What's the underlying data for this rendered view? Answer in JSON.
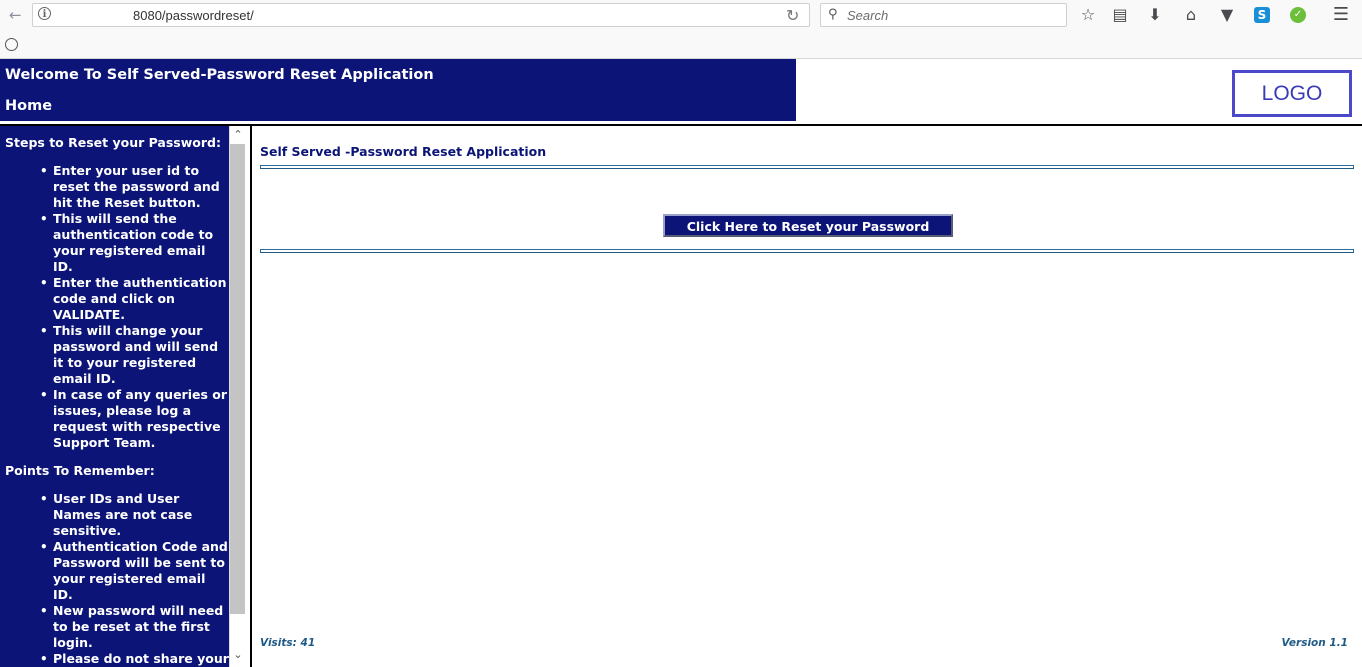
{
  "browser": {
    "url": "8080/passwordreset/",
    "search_placeholder": "Search"
  },
  "header": {
    "title": "Welcome To       Self Served-Password Reset Application",
    "home_link": "Home",
    "logo_text": "LOGO"
  },
  "sidebar": {
    "steps_heading": "Steps to Reset your       Password:",
    "steps": [
      "Enter your user id to reset the password and hit the Reset button.",
      "This will send the authentication code to your registered email ID.",
      "Enter the authentication code and click on VALIDATE.",
      "This will change your password and will send it to your registered email ID.",
      "In case of any queries or issues, please log a       request with respective Support Team."
    ],
    "points_heading": "Points To Remember:",
    "points": [
      "User IDs and User Names are not case sensitive.",
      "Authentication Code and Password will be sent to your registered email ID.",
      "New password will need to be reset at the first login.",
      "Please do not share your password with any"
    ]
  },
  "main": {
    "heading": "Self Served       -Password Reset Application",
    "reset_button": "Click Here to Reset your       Password",
    "visits": "Visits: 41",
    "version": "Version 1.1"
  }
}
